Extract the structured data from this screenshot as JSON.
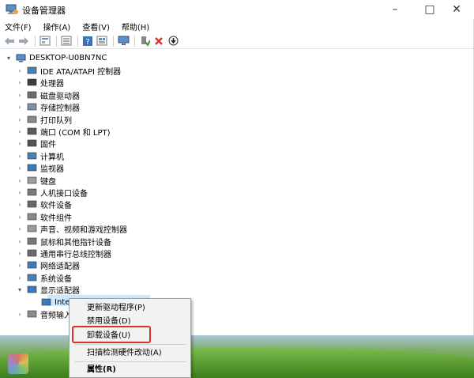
{
  "window": {
    "title": "设备管理器",
    "minimize": "–",
    "maximize": "□",
    "close": "✕"
  },
  "menus": [
    "文件(F)",
    "操作(A)",
    "查看(V)",
    "帮助(H)"
  ],
  "toolbar": [
    "back-icon",
    "forward-icon",
    "properties-icon",
    "list-icon",
    "help-icon",
    "view-icon",
    "monitor-icon",
    "enable-icon",
    "uninstall-icon",
    "update-icon"
  ],
  "tree": {
    "root": "DESKTOP-U0BN7NC",
    "items": [
      {
        "label": "IDE ATA/ATAPI 控制器",
        "icon": "ide-icon"
      },
      {
        "label": "处理器",
        "icon": "cpu-icon"
      },
      {
        "label": "磁盘驱动器",
        "icon": "disk-icon"
      },
      {
        "label": "存储控制器",
        "icon": "storage-icon"
      },
      {
        "label": "打印队列",
        "icon": "printer-icon"
      },
      {
        "label": "端口 (COM 和 LPT)",
        "icon": "port-icon"
      },
      {
        "label": "固件",
        "icon": "firmware-icon"
      },
      {
        "label": "计算机",
        "icon": "computer-icon"
      },
      {
        "label": "监视器",
        "icon": "monitor-icon"
      },
      {
        "label": "键盘",
        "icon": "keyboard-icon"
      },
      {
        "label": "人机接口设备",
        "icon": "hid-icon"
      },
      {
        "label": "软件设备",
        "icon": "software-device-icon"
      },
      {
        "label": "软件组件",
        "icon": "software-component-icon"
      },
      {
        "label": "声音、视频和游戏控制器",
        "icon": "sound-icon"
      },
      {
        "label": "鼠标和其他指针设备",
        "icon": "mouse-icon"
      },
      {
        "label": "通用串行总线控制器",
        "icon": "usb-icon"
      },
      {
        "label": "网络适配器",
        "icon": "network-icon"
      },
      {
        "label": "系统设备",
        "icon": "system-icon"
      },
      {
        "label": "显示适配器",
        "icon": "display-icon",
        "expanded": true
      },
      {
        "label": "Intel(R) UHD Graphics 630",
        "icon": "gpu-icon",
        "child": true,
        "selected": true
      },
      {
        "label": "音频输入和输出",
        "icon": "audio-icon"
      }
    ]
  },
  "context_menu": {
    "items": [
      "更新驱动程序(P)",
      "禁用设备(D)",
      "卸载设备(U)",
      "扫描检测硬件改动(A)",
      "属性(R)"
    ]
  },
  "colors": {
    "highlight_border": "#d6322c",
    "selection": "#cce8ff"
  }
}
